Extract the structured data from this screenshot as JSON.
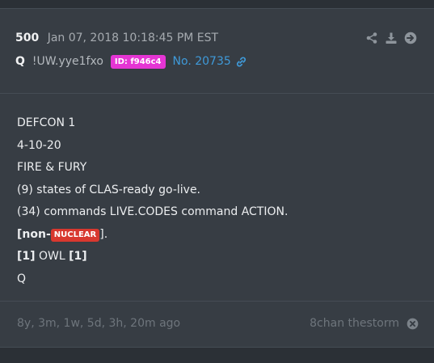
{
  "post": {
    "number": "500",
    "date": "Jan 07, 2018 10:18:45 PM EST",
    "author": "Q",
    "tripcode": "!UW.yye1fxo",
    "id_badge": "ID: f946c4",
    "post_link": "No. 20735"
  },
  "actions": {
    "icons": [
      "share-icon",
      "download-icon",
      "arrow-right-circle-icon"
    ]
  },
  "message": {
    "lines": [
      "DEFCON 1",
      "4-10-20",
      "FIRE & FURY",
      "(9) states of CLAS-ready go-live.",
      "(34) commands LIVE.CODES command ACTION."
    ],
    "non_prefix": "[non-",
    "nuclear_badge": "NUCLEAR",
    "non_suffix": "].",
    "owl_open": "[1]",
    "owl_word": " OWL ",
    "owl_close": "[1]",
    "signoff": "Q"
  },
  "footer": {
    "ago": "8y, 3m, 1w, 5d, 3h, 20m ago",
    "source": "8chan thestorm"
  },
  "colors": {
    "background": "#2b3036",
    "card": "#373d44",
    "id_badge": "#e535d4",
    "link": "#3f9ad9",
    "nuclear_badge": "#d8382f"
  }
}
